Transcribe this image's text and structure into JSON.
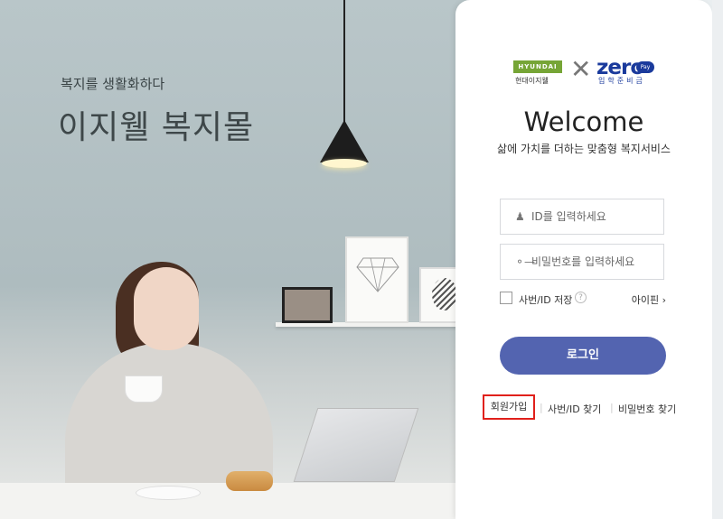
{
  "hero": {
    "subtitle": "복지를 생활화하다",
    "title": "이지웰 복지몰"
  },
  "logos": {
    "hyundai_mark": "HYUNDAI",
    "hyundai_name": "현대이지웰",
    "cross": "✕",
    "zero": "zero",
    "zero_pay": "Pay",
    "zero_sub": "입학준비금"
  },
  "login": {
    "welcome": "Welcome",
    "tagline": "삶에 가치를 더하는 맞춤형 복지서비스",
    "id_placeholder": "ID를 입력하세요",
    "id_icon": "user-icon",
    "pw_placeholder": "비밀번호를 입력하세요",
    "pw_icon": "key-icon",
    "save_label": "사번/ID 저장",
    "help": "?",
    "ipin": "아이핀 ›",
    "button": "로그인"
  },
  "links": {
    "signup": "회원가입",
    "find_id": "사번/ID 찾기",
    "find_pw": "비밀번호 찾기",
    "separator": "|"
  },
  "colors": {
    "login_button": "#5364b0",
    "highlight_border": "#e0201b",
    "hyundai_green": "#76a536",
    "zero_blue": "#1a3a9c"
  }
}
